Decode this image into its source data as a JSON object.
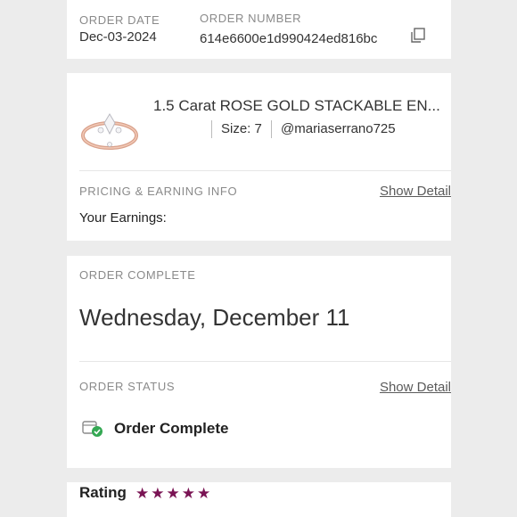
{
  "order": {
    "date_label": "ORDER DATE",
    "date_value": "Dec-03-2024",
    "number_label": "ORDER NUMBER",
    "number_value": "614e6600e1d990424ed816bc"
  },
  "item": {
    "title": "1.5 Carat ROSE GOLD STACKABLE EN...",
    "size": "Size: 7",
    "seller": "@mariaserrano725"
  },
  "pricing": {
    "section_label": "PRICING & EARNING INFO",
    "show_detail": "Show Detail",
    "earnings_label": "Your Earnings:"
  },
  "complete": {
    "section_label": "ORDER COMPLETE",
    "date": "Wednesday, December 11"
  },
  "status": {
    "section_label": "ORDER STATUS",
    "show_detail": "Show Detail",
    "value": "Order Complete"
  },
  "rating": {
    "label": "Rating",
    "stars": 5,
    "star_color": "#7a1454"
  }
}
